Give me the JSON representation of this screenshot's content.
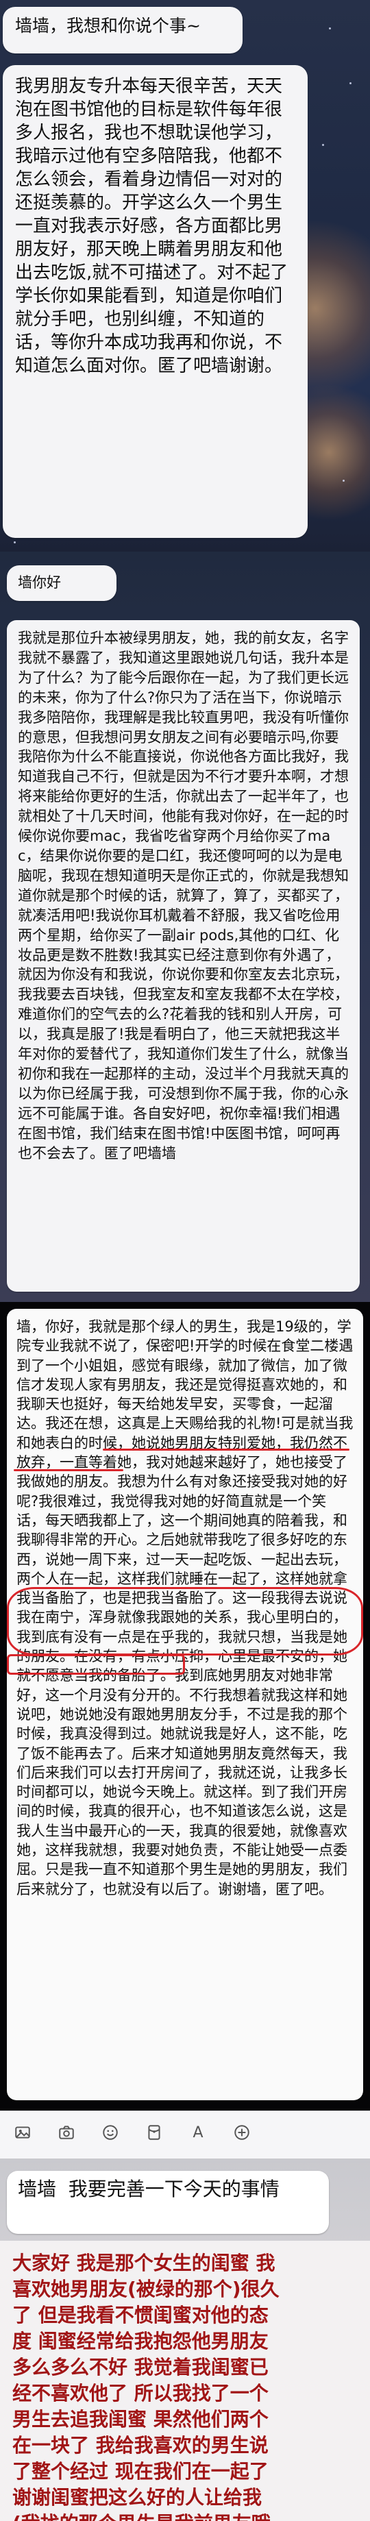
{
  "chat1": {
    "message_title": "墙墙，我想和你说个事~",
    "message_body": "我男朋友专升本每天很辛苦，天天泡在图书馆他的目标是软件每年很多人报名，我也不想耽误他学习，我暗示过他有空多陪陪我，他都不怎么领会，看着身边情侣一对对的还挺羡慕的。开学这么久一个男生一直对我表示好感，各方面都比男朋友好，那天晚上瞒着男朋友和他出去吃饭,就不可描述了。对不起了学长你如果能看到，知道是你咱们就分手吧，也别纠缠，不知道的话，等你升本成功我再和你说，不知道怎么面对你。匿了吧墙谢谢。"
  },
  "chat2": {
    "message_title": "墙你好",
    "message_body": "我就是那位升本被绿男朋友，她，我的前女友，名字我就不暴露了，我知道这里跟她说几句话，我升本是为了什么？为了能今后跟你在一起，为了我们更长远的未来，你为了什么?你只为了活在当下，你说暗示我多陪陪你，我理解是我比较直男吧，我没有听懂你的意思，但我想问男女朋友之间有必要暗示吗,你要我陪你为什么不能直接说，你说他各方面比我好，我知道我自己不行，但就是因为不行才要升本啊，才想将来能给你更好的生活，你就出去了一起半年了，也就相处了十几天时间，他能有我对你好，在一起的时候你说你要mac，我省吃省穿两个月给你买了mac，结果你说你要的是口红，我还傻呵呵的以为是电脑呢，我现在想知道明天是你正式的，你就是我想知道你就是那个时候的话，就算了，算了，买都买了，就凑活用吧!我说你耳机戴着不舒服，我又省吃俭用两个星期，给你买了一副air pods,其他的口红、化妆品更是数不胜数!我其实已经注意到你有外遇了，就因为你没有和我说，你说你要和你室友去北京玩，我我要去百块钱，但我室友和室友我都不太在学校，难道你们的空气去的么?花着我的钱和别人开房，可以，我真是服了!我是看明白了，他三天就把我这半年对你的爱替代了，我知道你们发生了什么，就像当初你和我在一起那样的主动，没过半个月我就天真的以为你已经属于我，可没想到你不属于我，你的心永远不可能属于谁。各自安好吧，祝你幸福!我们相遇在图书馆，我们结束在图书馆!中医图书馆，呵呵再也不会去了。匿了吧墙墙"
  },
  "chat3": {
    "message_body": "墙，你好，我就是那个绿人的男生，我是19级的，学院专业我就不说了，保密吧!开学的时候在食堂二楼遇到了一个小姐姐，感觉有眼缘，就加了微信，加了微信才发现人家有男朋友，我还是觉得挺喜欢她的，和我聊天也挺好，每天给她发早安，买零食，一起溜达。我还在想，这真是上天赐给我的礼物!可是就当我和她表白的时候，她说她男朋友特别爱她，我仍然不放弃，一直等着她，我对她越来越好了，她也接受了我做她的朋友。我想为什么有对象还接受我对她的好呢?我很难过，我觉得我对她的好简直就是一个笑话，每天晒我都上了，这一个期间她真的陪着我，和我聊得非常的开心。之后她就带我吃了很多好吃的东西，说她一周下来，过一天一起吃饭、一起出去玩，两个人在一起，这样我们就睡在一起了，这样她就拿我当备胎了，也是把我当备胎了。这一段我得去说说我在南宁，浑身就像我跟她的关系，我心里明白的，我到底有没有一点是在乎我的，我就只想，当我是她的朋友。在没有，有点小压抑，心里是最不安的，她就不愿意当我的备胎了。我到底她男朋友对她非常好，这一个月没有分开的。不行我想着就我这样和她说吧，她说她没有跟她男朋友分手，不过是我的那个时候，我真没得到过。她就说我是好人，这不能，吃了饭不能再去了。后来才知道她男朋友竟然每天，我们后来我们可以去打开房间了，我就还说，让我多长时间都可以，她说今天晚上。就这样。到了我们开房间的时候，我真的很开心，也不知道该怎么说，这是我人生当中最开心的一天，我真的很爱她，就像喜欢她，这样我就想，我要对她负责，不能让她受一点委屈。只是我一直不知道那个男生是她的男朋友，我们后来就分了，也就没有以后了。谢谢墙，匿了吧。"
  },
  "toolbar": {
    "icons": [
      "image-icon",
      "camera-icon",
      "face-icon",
      "red-packet-icon",
      "capital-icon",
      "add-icon"
    ]
  },
  "chat4": {
    "message_body": "墙墙  我要完善一下今天的事情"
  },
  "note": {
    "body": "大家好 我是那个女生的闺蜜 我喜欢她男朋友(被绿的那个)很久了 但是我看不惯闺蜜对他的态度 闺蜜经常给我抱怨他男朋友多么多么不好 我觉着我闺蜜已经不喜欢他了 所以我找了一个男生去追我闺蜜 果然他们两个在一块了 我给我喜欢的男生说了整个经过 现在我们在一起了 谢谢闺蜜把这么好的人让给我 (我找的那个男生是我前男友哦十足的渣男) bzpg 天长地久"
  }
}
